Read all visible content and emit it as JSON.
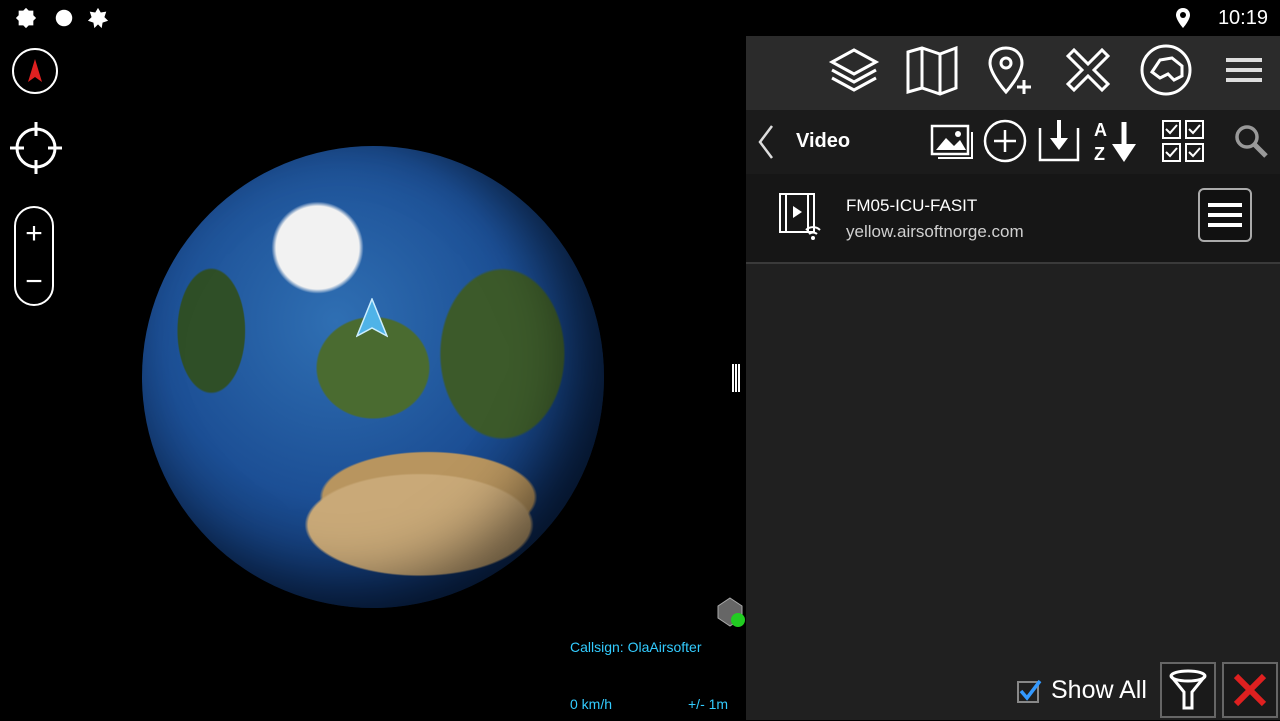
{
  "status": {
    "time": "10:19"
  },
  "map": {
    "callsign": "Callsign: OlaAirsofter",
    "speed": "0 km/h",
    "accuracy": "+/- 1m"
  },
  "panel": {
    "title": "Video",
    "items": [
      {
        "name": "FM05-ICU-FASIT",
        "address": "yellow.airsoftnorge.com"
      }
    ],
    "footer": {
      "show_all_label": "Show All",
      "show_all_checked": true
    }
  },
  "colors": {
    "accent": "#33ccff",
    "close_red": "#e02020",
    "check_blue": "#3399ff"
  }
}
